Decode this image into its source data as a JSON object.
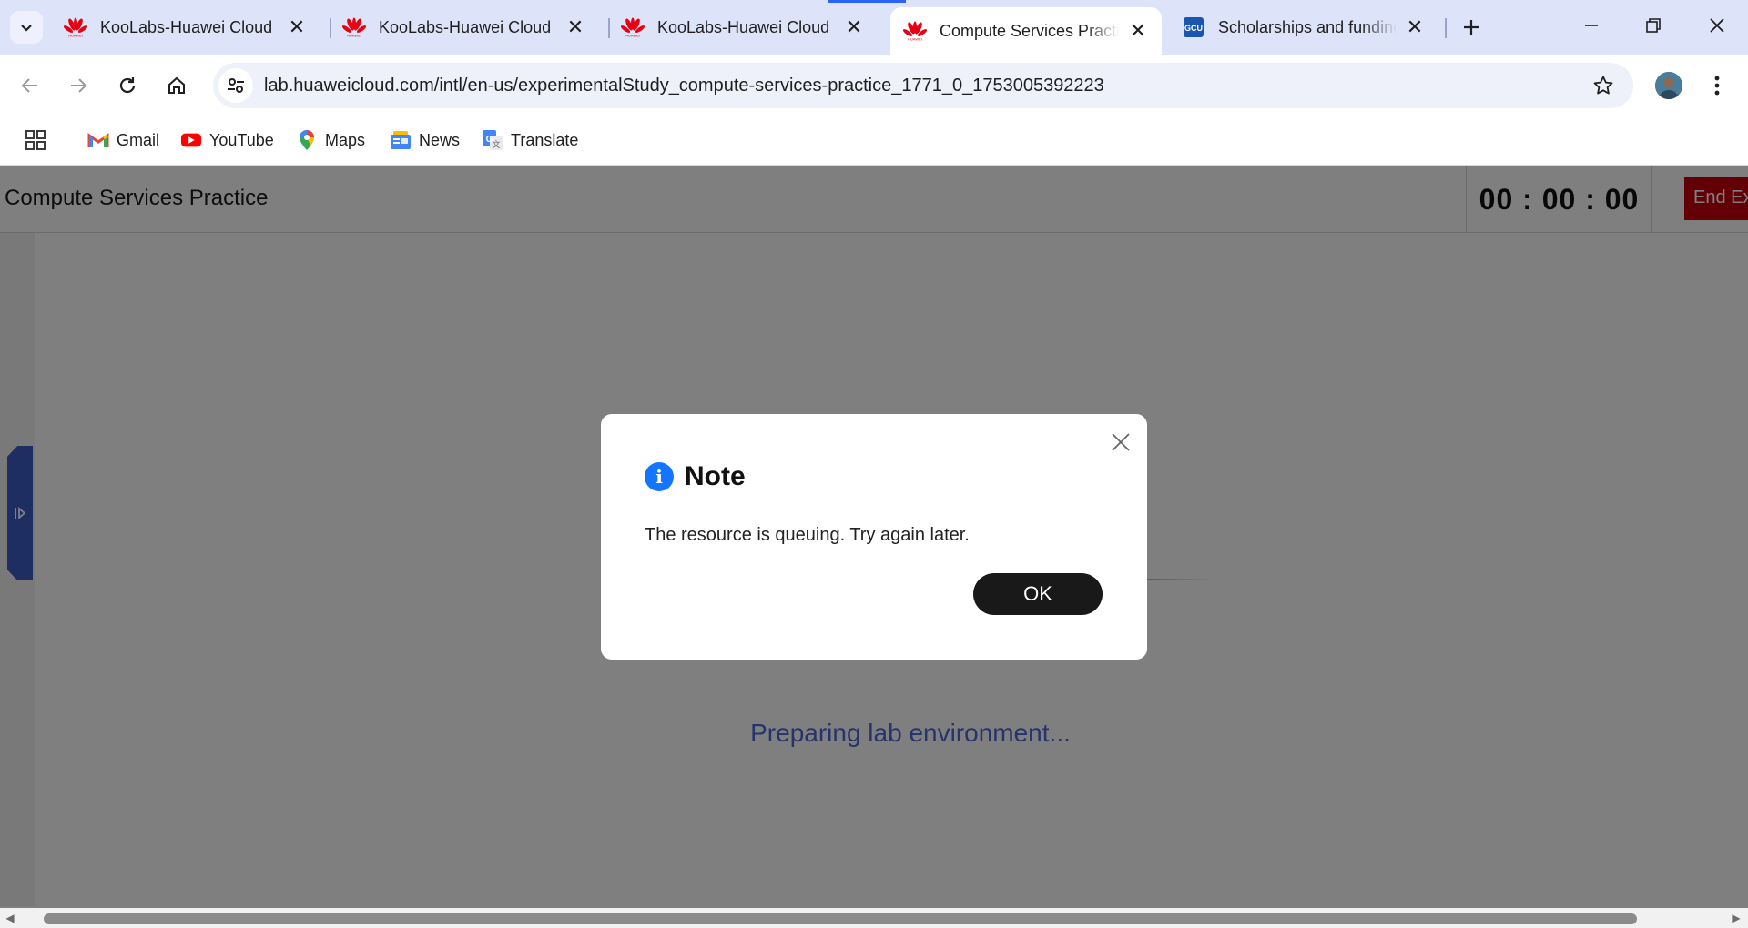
{
  "browser": {
    "tabs": [
      {
        "title": "KooLabs-Huawei Cloud",
        "favicon": "huawei-logo-icon",
        "active": false
      },
      {
        "title": "KooLabs-Huawei Cloud",
        "favicon": "huawei-logo-icon",
        "active": false
      },
      {
        "title": "KooLabs-Huawei Cloud",
        "favicon": "huawei-logo-icon",
        "active": false
      },
      {
        "title": "Compute Services Practice",
        "favicon": "huawei-logo-icon",
        "active": true
      },
      {
        "title": "Scholarships and funding",
        "favicon": "gcu-logo-icon",
        "active": false
      }
    ],
    "url": "lab.huaweicloud.com/intl/en-us/experimentalStudy_compute-services-practice_1771_0_1753005392223",
    "bookmarks": [
      {
        "label": "Gmail",
        "icon": "gmail-icon"
      },
      {
        "label": "YouTube",
        "icon": "youtube-icon"
      },
      {
        "label": "Maps",
        "icon": "maps-icon"
      },
      {
        "label": "News",
        "icon": "news-icon"
      },
      {
        "label": "Translate",
        "icon": "translate-icon"
      }
    ]
  },
  "lab": {
    "title": "Compute Services Practice",
    "timer": "00 : 00 : 00",
    "end_button": "End Exercise",
    "status_text": "Preparing lab environment..."
  },
  "dialog": {
    "title": "Note",
    "message": "The resource is queuing. Try again later.",
    "ok_label": "OK"
  },
  "colors": {
    "accent_blue": "#1476ff",
    "end_button_red": "#c7000b",
    "status_text": "#4f68d8",
    "huawei_red": "#e60012"
  }
}
